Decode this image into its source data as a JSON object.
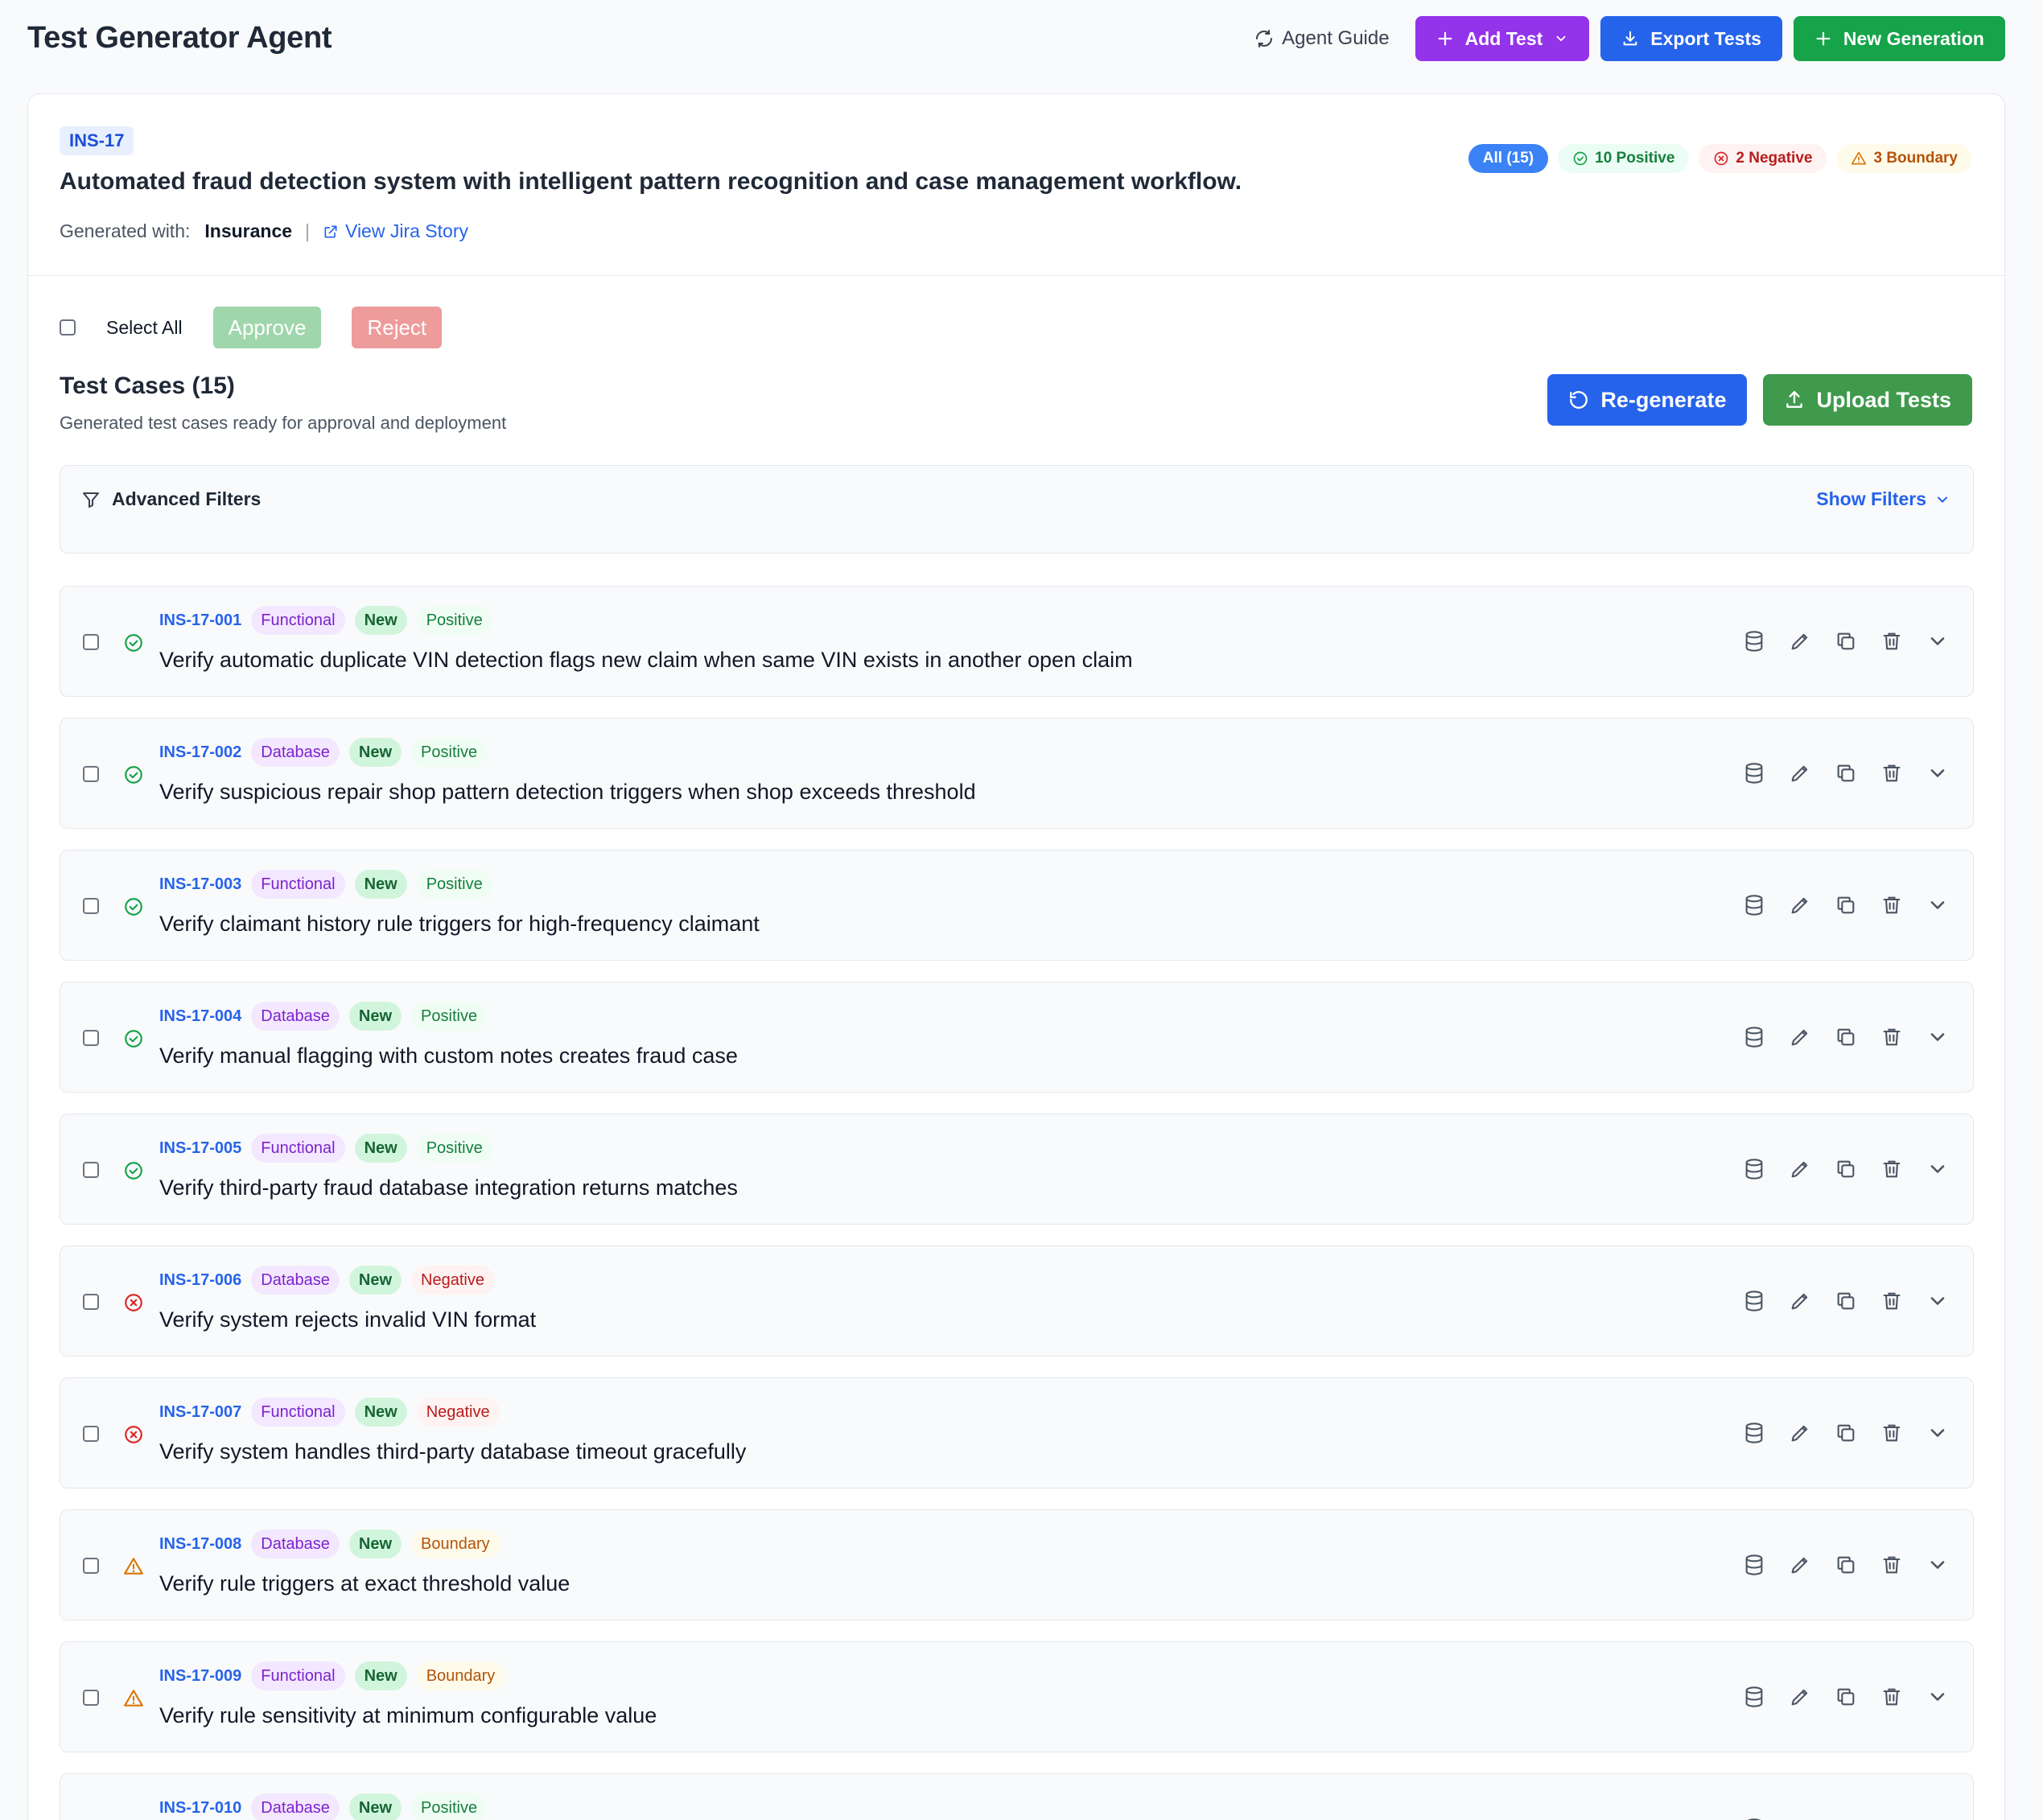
{
  "app": {
    "title": "Test Generator Agent",
    "agent_guide": "Agent Guide",
    "add_test": "Add Test",
    "export_tests": "Export Tests",
    "new_generation": "New Generation"
  },
  "story": {
    "key": "INS-17",
    "title": "Automated fraud detection system with intelligent pattern recognition and case management workflow.",
    "generated_with_label": "Generated with:",
    "generated_with_value": "Insurance",
    "separator": "|",
    "jira_link": "View Jira Story"
  },
  "counts": {
    "all": "All (15)",
    "positive": "10 Positive",
    "negative": "2 Negative",
    "boundary": "3 Boundary"
  },
  "bulk": {
    "select_all": "Select All",
    "approve": "Approve",
    "reject": "Reject"
  },
  "test_cases": {
    "title": "Test Cases (15)",
    "subtitle": "Generated test cases ready for approval and deployment",
    "regenerate": "Re-generate",
    "upload": "Upload Tests"
  },
  "filters": {
    "title": "Advanced Filters",
    "show": "Show Filters"
  },
  "colors": {
    "positive": "#16a34a",
    "negative": "#dc2626",
    "boundary": "#d97706",
    "primary": "#2563eb",
    "purple": "#9333ea"
  },
  "rows": [
    {
      "id": "INS-17-001",
      "type": "Functional",
      "status": "New",
      "polarity": "Positive",
      "title": "Verify automatic duplicate VIN detection flags new claim when same VIN exists in another open claim"
    },
    {
      "id": "INS-17-002",
      "type": "Database",
      "status": "New",
      "polarity": "Positive",
      "title": "Verify suspicious repair shop pattern detection triggers when shop exceeds threshold"
    },
    {
      "id": "INS-17-003",
      "type": "Functional",
      "status": "New",
      "polarity": "Positive",
      "title": "Verify claimant history rule triggers for high-frequency claimant"
    },
    {
      "id": "INS-17-004",
      "type": "Database",
      "status": "New",
      "polarity": "Positive",
      "title": "Verify manual flagging with custom notes creates fraud case"
    },
    {
      "id": "INS-17-005",
      "type": "Functional",
      "status": "New",
      "polarity": "Positive",
      "title": "Verify third-party fraud database integration returns matches"
    },
    {
      "id": "INS-17-006",
      "type": "Database",
      "status": "New",
      "polarity": "Negative",
      "title": "Verify system rejects invalid VIN format"
    },
    {
      "id": "INS-17-007",
      "type": "Functional",
      "status": "New",
      "polarity": "Negative",
      "title": "Verify system handles third-party database timeout gracefully"
    },
    {
      "id": "INS-17-008",
      "type": "Database",
      "status": "New",
      "polarity": "Boundary",
      "title": "Verify rule triggers at exact threshold value"
    },
    {
      "id": "INS-17-009",
      "type": "Functional",
      "status": "New",
      "polarity": "Boundary",
      "title": "Verify rule sensitivity at minimum configurable value"
    },
    {
      "id": "INS-17-010",
      "type": "Database",
      "status": "New",
      "polarity": "Positive",
      "title": ""
    }
  ],
  "row_action_icons": [
    "database-icon",
    "edit-icon",
    "copy-icon",
    "trash-icon",
    "chevron-down-icon"
  ]
}
